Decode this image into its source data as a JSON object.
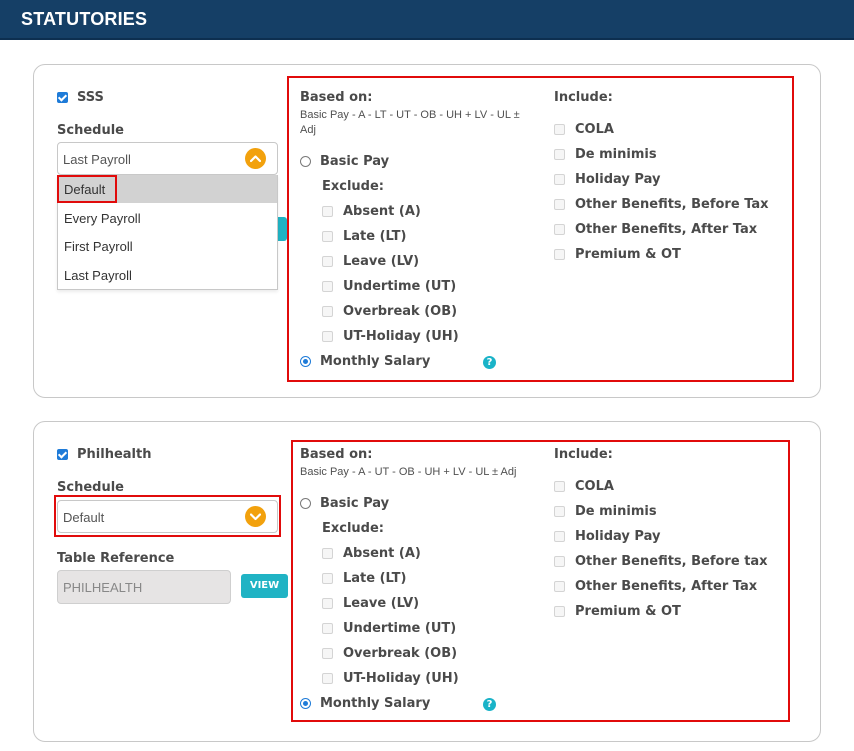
{
  "header": {
    "title": "STATUTORIES"
  },
  "sss": {
    "enabled_label": "SSS",
    "schedule_label": "Schedule",
    "schedule_value": "Last Payroll",
    "dropdown_options": [
      "Default",
      "Every Payroll",
      "First Payroll",
      "Last Payroll"
    ],
    "highlighted_option": "Default",
    "based_on_label": "Based on:",
    "formula_line1": "Basic Pay - A - LT - UT - OB - UH + LV - UL ±",
    "formula_line2": "Adj",
    "basic_pay": "Basic Pay",
    "exclude_label": "Exclude:",
    "exclude_items": [
      "Absent (A)",
      "Late (LT)",
      "Leave (LV)",
      "Undertime (UT)",
      "Overbreak (OB)",
      "UT-Holiday (UH)"
    ],
    "monthly_salary": "Monthly Salary",
    "include_label": "Include:",
    "include_items": [
      "COLA",
      "De minimis",
      "Holiday Pay",
      "Other Benefits, Before Tax",
      "Other Benefits, After Tax",
      "Premium & OT"
    ],
    "selected_basis": "Monthly Salary"
  },
  "philhealth": {
    "enabled_label": "Philhealth",
    "schedule_label": "Schedule",
    "schedule_value": "Default",
    "table_reference_label": "Table Reference",
    "table_reference_value": "PHILHEALTH",
    "view_button": "VIEW",
    "based_on_label": "Based on:",
    "formula_line1": "Basic Pay - A - UT - OB - UH + LV - UL ± Adj",
    "basic_pay": "Basic Pay",
    "exclude_label": "Exclude:",
    "exclude_items": [
      "Absent (A)",
      "Late (LT)",
      "Leave (LV)",
      "Undertime (UT)",
      "Overbreak (OB)",
      "UT-Holiday (UH)"
    ],
    "monthly_salary": "Monthly Salary",
    "include_label": "Include:",
    "include_items": [
      "COLA",
      "De minimis",
      "Holiday Pay",
      "Other Benefits, Before tax",
      "Other Benefits, After Tax",
      "Premium & OT"
    ],
    "selected_basis": "Monthly Salary"
  },
  "icons": {
    "help": "?",
    "chevron_up": "chevron-up-icon",
    "chevron_down": "chevron-down-icon"
  },
  "colors": {
    "header_bg": "#153f66",
    "accent_blue": "#1e7bd8",
    "chevron_orange": "#f2a10d",
    "highlight_red": "#e10b0b",
    "teal": "#20b3c4"
  }
}
